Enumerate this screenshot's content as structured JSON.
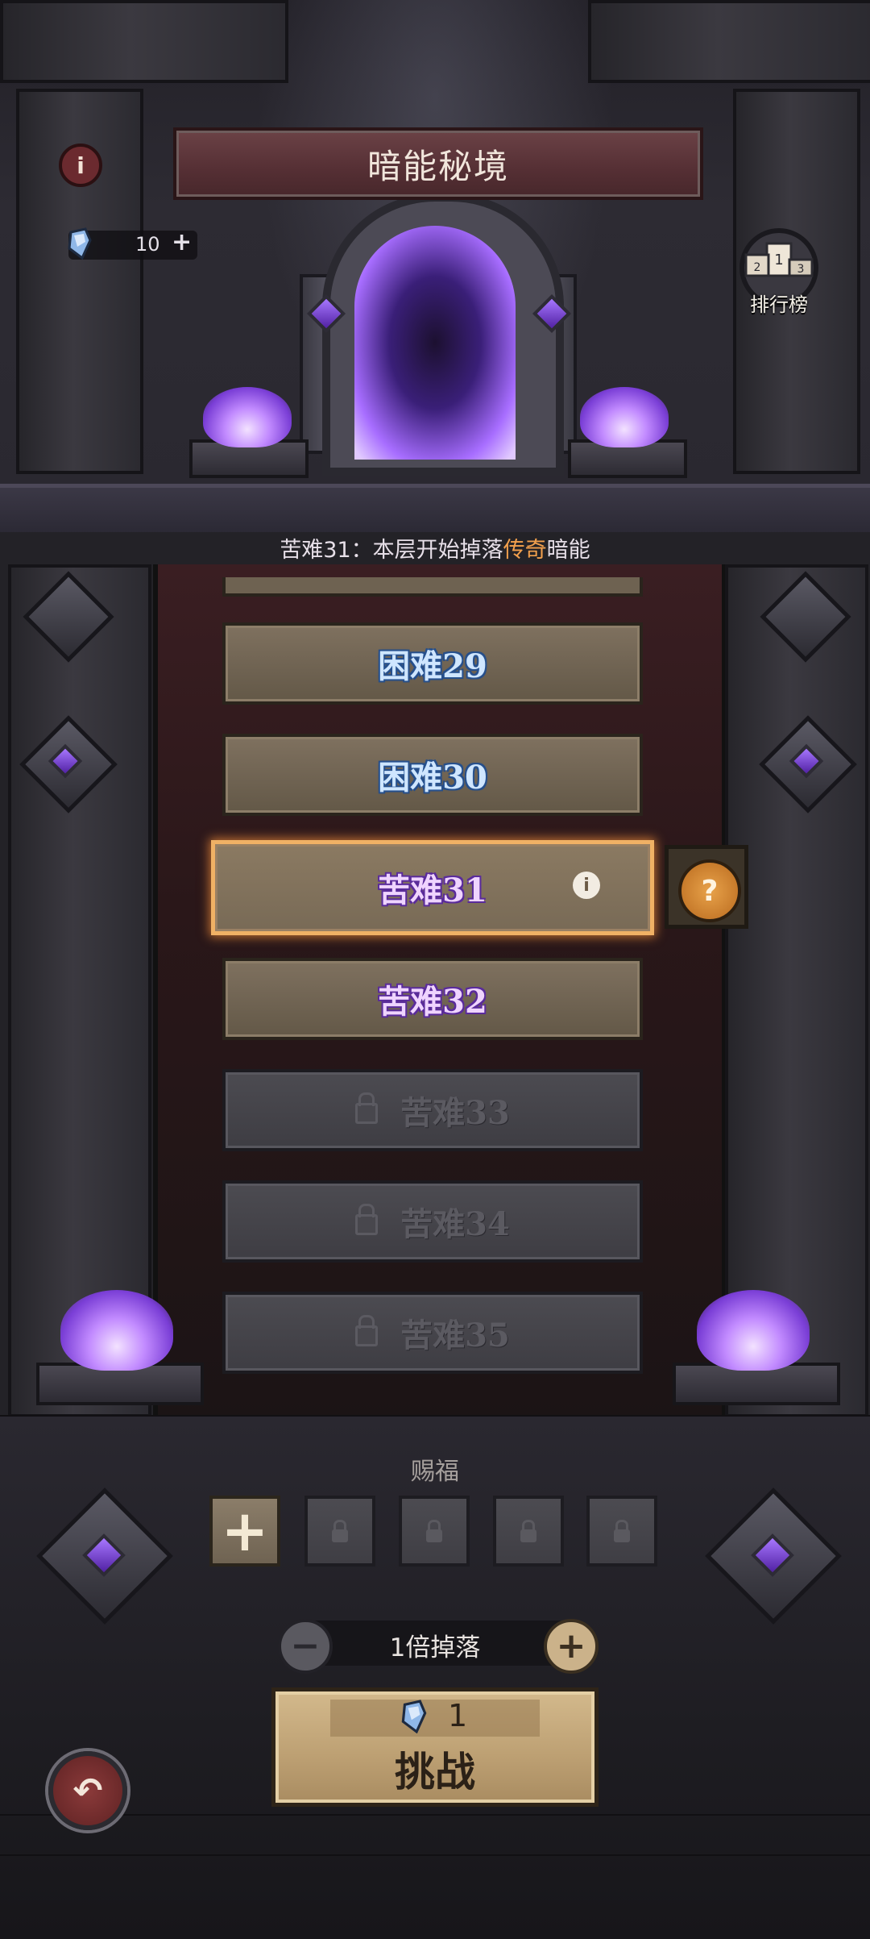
{
  "header": {
    "title": "暗能秘境",
    "currency_value": "10",
    "rank_label": "排行榜"
  },
  "notice": {
    "prefix": "苦难31：本层开始掉落",
    "highlight": "传奇",
    "suffix": "暗能"
  },
  "levels": [
    {
      "label": "困难29",
      "state": "unlocked",
      "tier": "hard"
    },
    {
      "label": "困难30",
      "state": "unlocked",
      "tier": "hard"
    },
    {
      "label": "苦难31",
      "state": "selected",
      "tier": "pain"
    },
    {
      "label": "苦难32",
      "state": "unlocked",
      "tier": "pain"
    },
    {
      "label": "苦难33",
      "state": "locked",
      "tier": "pain"
    },
    {
      "label": "苦难34",
      "state": "locked",
      "tier": "pain"
    },
    {
      "label": "苦难35",
      "state": "locked",
      "tier": "pain"
    }
  ],
  "blessing": {
    "title": "赐福",
    "slots": [
      "add",
      "locked",
      "locked",
      "locked",
      "locked"
    ]
  },
  "drop": {
    "label": "1倍掉落"
  },
  "challenge": {
    "cost": "1",
    "label": "挑战"
  },
  "icons": {
    "info": "info-icon",
    "help": "question-icon",
    "back": "back-arrow-icon",
    "currency": "dark-energy-crystal-icon",
    "rank": "podium-icon"
  },
  "colors": {
    "highlight": "#f2a04d",
    "selected_glow": "#f0b165",
    "hard_text": "#cfe6ff",
    "pain_text": "#efd4ff"
  }
}
